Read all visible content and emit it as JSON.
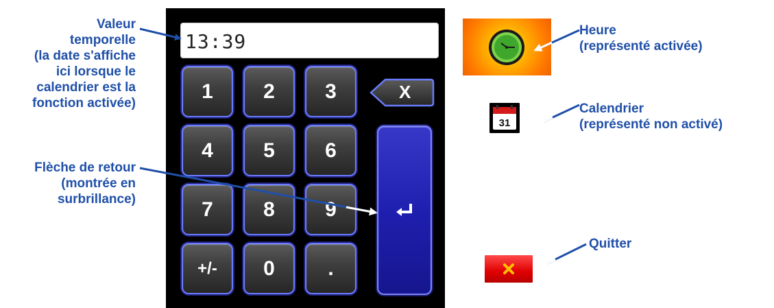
{
  "display": {
    "value": "13:39"
  },
  "keypad": {
    "keys": [
      {
        "label": "1"
      },
      {
        "label": "2"
      },
      {
        "label": "3"
      },
      {
        "label": "4"
      },
      {
        "label": "5"
      },
      {
        "label": "6"
      },
      {
        "label": "7"
      },
      {
        "label": "8"
      },
      {
        "label": "9"
      },
      {
        "label": "+/-"
      },
      {
        "label": "0"
      },
      {
        "label": "."
      }
    ],
    "backspace_label": "X"
  },
  "side_buttons": {
    "calendar_day": "31"
  },
  "annotations": {
    "valeur": "Valeur\ntemporelle\n(la date s'affiche\nici lorsque le\ncalendrier est la\nfonction activée)",
    "fleche": "Flèche de retour\n(montrée en\nsurbrillance)",
    "heure": "Heure\n(représenté activée)",
    "calendrier": "Calendrier\n(représenté non activé)",
    "quitter": "Quitter"
  },
  "colors": {
    "annotation_text": "#1f4fa8",
    "key_outline": "#6a7cff",
    "enter_key": "#1f1fb0",
    "clock_button": "#ff8a00",
    "quit_button": "#e00000"
  },
  "icons": {
    "clock": "clock-icon",
    "calendar": "calendar-icon",
    "enter": "enter-return-icon",
    "quit": "close-icon"
  }
}
